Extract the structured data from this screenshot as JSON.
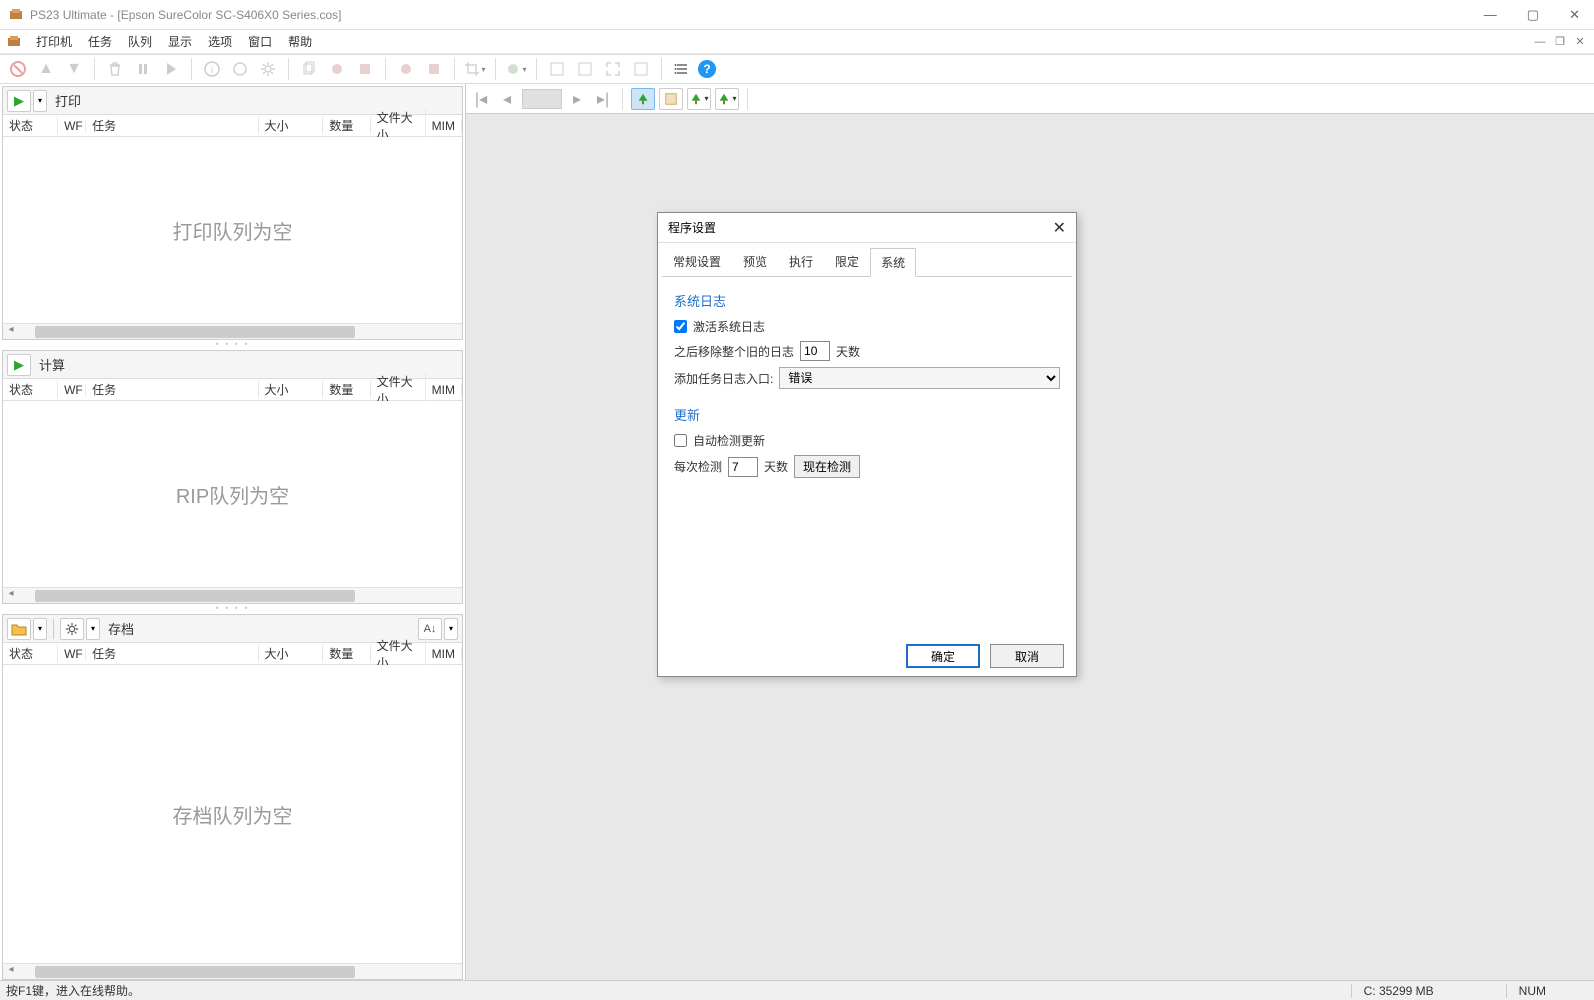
{
  "titlebar": {
    "title": "PS23 Ultimate - [Epson SureColor SC-S406X0 Series.cos]"
  },
  "menu": {
    "items": [
      "打印机",
      "任务",
      "队列",
      "显示",
      "选项",
      "窗口",
      "帮助"
    ]
  },
  "columns": {
    "status": "状态",
    "wf": "WF",
    "task": "任务",
    "size": "大小",
    "qty": "数量",
    "filesize": "文件大小",
    "mim": "MIM"
  },
  "panels": {
    "print": {
      "label": "打印",
      "empty": "打印队列为空"
    },
    "calc": {
      "label": "计算",
      "empty": "RIP队列为空"
    },
    "arch": {
      "label": "存档",
      "empty": "存档队列为空"
    }
  },
  "dialog": {
    "title": "程序设置",
    "tabs": [
      "常规设置",
      "预览",
      "执行",
      "限定",
      "系统"
    ],
    "active_tab": "系统",
    "sys": {
      "section1": "系统日志",
      "cb_activate": "激活系统日志",
      "remove_prefix": "之后移除整个旧的日志",
      "remove_value": "10",
      "remove_suffix": "天数",
      "addlog_label": "添加任务日志入口:",
      "addlog_value": "错误"
    },
    "upd": {
      "section2": "更新",
      "cb_auto": "自动检测更新",
      "every_prefix": "每次检测",
      "every_value": "7",
      "every_suffix": "天数",
      "check_now": "现在检测"
    },
    "ok": "确定",
    "cancel": "取消"
  },
  "status": {
    "hint": "按F1键，进入在线帮助。",
    "disk": "C: 35299 MB",
    "num": "NUM"
  }
}
